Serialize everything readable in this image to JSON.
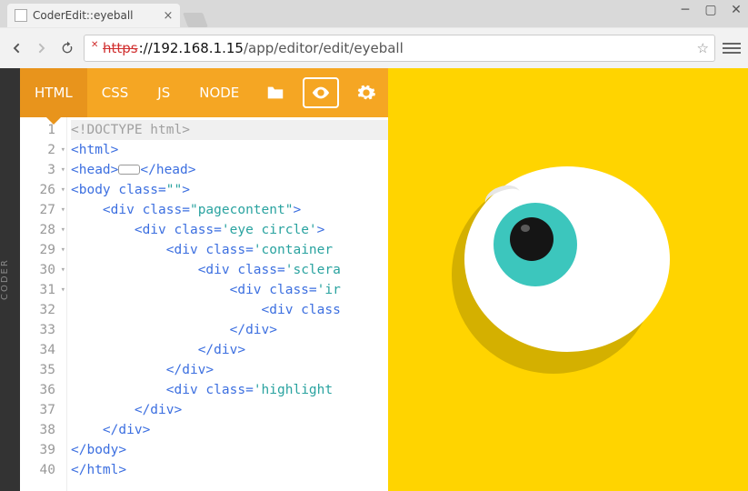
{
  "browser": {
    "tab_title": "CoderEdit::eyeball",
    "url_scheme": "https",
    "url_host": "://192.168.1.15",
    "url_path": "/app/editor/edit/eyeball"
  },
  "rail": {
    "label": "CODER"
  },
  "toolbar": {
    "tabs": [
      "HTML",
      "CSS",
      "JS",
      "NODE"
    ],
    "active_tab": 0
  },
  "code": {
    "lines": [
      {
        "n": "1",
        "fold": false,
        "hl": true,
        "seg": [
          {
            "c": "t-doctype",
            "t": "<!DOCTYPE html>"
          }
        ]
      },
      {
        "n": "2",
        "fold": true,
        "seg": [
          {
            "c": "t-tag",
            "t": "<html>"
          }
        ]
      },
      {
        "n": "3",
        "fold": true,
        "seg": [
          {
            "c": "t-tag",
            "t": "<head>"
          },
          {
            "c": "pill",
            "t": ""
          },
          {
            "c": "t-tag",
            "t": "</head>"
          }
        ]
      },
      {
        "n": "26",
        "fold": true,
        "seg": [
          {
            "c": "t-tag",
            "t": "<body "
          },
          {
            "c": "t-attr",
            "t": "class"
          },
          {
            "c": "t-tag",
            "t": "="
          },
          {
            "c": "t-str",
            "t": "\"\""
          },
          {
            "c": "t-tag",
            "t": ">"
          }
        ]
      },
      {
        "n": "27",
        "fold": true,
        "seg": [
          {
            "c": "",
            "t": "    "
          },
          {
            "c": "t-tag",
            "t": "<div "
          },
          {
            "c": "t-attr",
            "t": "class"
          },
          {
            "c": "t-tag",
            "t": "="
          },
          {
            "c": "t-str",
            "t": "\"pagecontent\""
          },
          {
            "c": "t-tag",
            "t": ">"
          }
        ]
      },
      {
        "n": "28",
        "fold": true,
        "seg": [
          {
            "c": "",
            "t": "        "
          },
          {
            "c": "t-tag",
            "t": "<div "
          },
          {
            "c": "t-attr",
            "t": "class"
          },
          {
            "c": "t-tag",
            "t": "="
          },
          {
            "c": "t-str",
            "t": "'eye circle'"
          },
          {
            "c": "t-tag",
            "t": ">"
          }
        ]
      },
      {
        "n": "29",
        "fold": true,
        "seg": [
          {
            "c": "",
            "t": "            "
          },
          {
            "c": "t-tag",
            "t": "<div "
          },
          {
            "c": "t-attr",
            "t": "class"
          },
          {
            "c": "t-tag",
            "t": "="
          },
          {
            "c": "t-str",
            "t": "'container"
          }
        ]
      },
      {
        "n": "30",
        "fold": true,
        "seg": [
          {
            "c": "",
            "t": "                "
          },
          {
            "c": "t-tag",
            "t": "<div "
          },
          {
            "c": "t-attr",
            "t": "class"
          },
          {
            "c": "t-tag",
            "t": "="
          },
          {
            "c": "t-str",
            "t": "'sclera"
          }
        ]
      },
      {
        "n": "31",
        "fold": true,
        "seg": [
          {
            "c": "",
            "t": "                    "
          },
          {
            "c": "t-tag",
            "t": "<div "
          },
          {
            "c": "t-attr",
            "t": "class"
          },
          {
            "c": "t-tag",
            "t": "="
          },
          {
            "c": "t-str",
            "t": "'ir"
          }
        ]
      },
      {
        "n": "32",
        "fold": false,
        "seg": [
          {
            "c": "",
            "t": "                        "
          },
          {
            "c": "t-tag",
            "t": "<div "
          },
          {
            "c": "t-attr",
            "t": "class"
          }
        ]
      },
      {
        "n": "33",
        "fold": false,
        "seg": [
          {
            "c": "",
            "t": "                    "
          },
          {
            "c": "t-tag",
            "t": "</div>"
          }
        ]
      },
      {
        "n": "34",
        "fold": false,
        "seg": [
          {
            "c": "",
            "t": "                "
          },
          {
            "c": "t-tag",
            "t": "</div>"
          }
        ]
      },
      {
        "n": "35",
        "fold": false,
        "seg": [
          {
            "c": "",
            "t": "            "
          },
          {
            "c": "t-tag",
            "t": "</div>"
          }
        ]
      },
      {
        "n": "36",
        "fold": false,
        "seg": [
          {
            "c": "",
            "t": "            "
          },
          {
            "c": "t-tag",
            "t": "<div "
          },
          {
            "c": "t-attr",
            "t": "class"
          },
          {
            "c": "t-tag",
            "t": "="
          },
          {
            "c": "t-str",
            "t": "'highlight"
          }
        ]
      },
      {
        "n": "37",
        "fold": false,
        "seg": [
          {
            "c": "",
            "t": "        "
          },
          {
            "c": "t-tag",
            "t": "</div>"
          }
        ]
      },
      {
        "n": "38",
        "fold": false,
        "seg": [
          {
            "c": "",
            "t": "    "
          },
          {
            "c": "t-tag",
            "t": "</div>"
          }
        ]
      },
      {
        "n": "39",
        "fold": false,
        "seg": [
          {
            "c": "t-tag",
            "t": "</body>"
          }
        ]
      },
      {
        "n": "40",
        "fold": false,
        "seg": [
          {
            "c": "t-tag",
            "t": "</html>"
          }
        ]
      }
    ]
  }
}
